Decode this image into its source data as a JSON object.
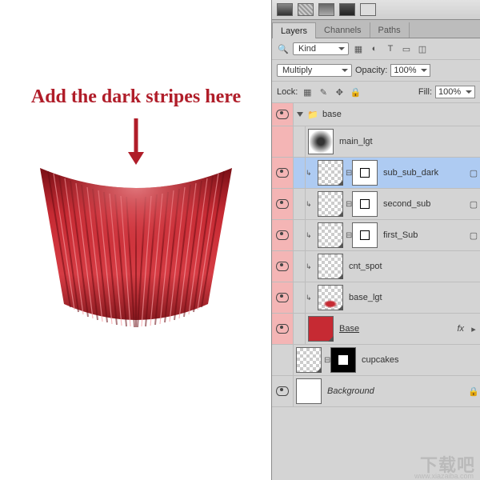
{
  "annotation": {
    "text": "Add the dark stripes here"
  },
  "panel": {
    "tabs": [
      "Layers",
      "Channels",
      "Paths"
    ],
    "active_tab": 0,
    "filter": {
      "kind": "Kind"
    },
    "blend_mode": "Multiply",
    "opacity_label": "Opacity:",
    "opacity_value": "100%",
    "lock_label": "Lock:",
    "fill_label": "Fill:",
    "fill_value": "100%"
  },
  "layers": {
    "group": "base",
    "items": [
      {
        "name": "main_lgt",
        "visible": false,
        "mask": false
      },
      {
        "name": "sub_sub_dark",
        "visible": true,
        "mask": true,
        "selected": true
      },
      {
        "name": "second_sub",
        "visible": true,
        "mask": true
      },
      {
        "name": "first_Sub",
        "visible": true,
        "mask": true
      },
      {
        "name": "cnt_spot",
        "visible": true,
        "mask": false
      },
      {
        "name": "base_lgt",
        "visible": true,
        "mask": false
      },
      {
        "name": "Base",
        "visible": true,
        "mask": false,
        "fx": true,
        "ul": true,
        "red": true
      }
    ],
    "below": [
      {
        "name": "cupcakes",
        "visible": false,
        "mask": true,
        "black_mask": true
      },
      {
        "name": "Background",
        "visible": true,
        "locked": true,
        "italic": true
      }
    ]
  },
  "watermark": {
    "main": "下载吧",
    "sub": "www.xiazaiba.com"
  }
}
